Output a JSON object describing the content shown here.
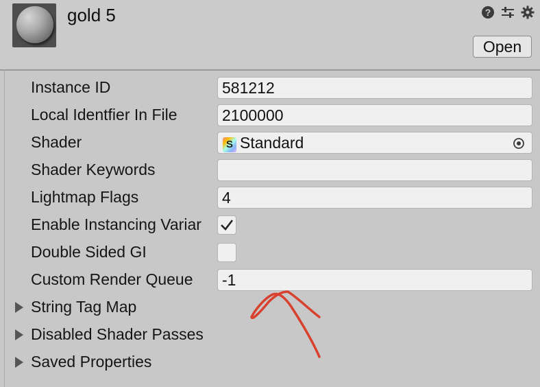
{
  "header": {
    "title": "gold 5",
    "open_label": "Open",
    "icons": [
      "help-icon",
      "presets-sliders-icon",
      "settings-gear-icon"
    ]
  },
  "properties": {
    "instance_id": {
      "label": "Instance ID",
      "value": "581212"
    },
    "local_identifier": {
      "label": "Local Identfier In File",
      "value": "2100000"
    },
    "shader": {
      "label": "Shader",
      "value": "Standard",
      "icon_letter": "S"
    },
    "shader_keywords": {
      "label": "Shader Keywords",
      "value": ""
    },
    "lightmap_flags": {
      "label": "Lightmap Flags",
      "value": "4"
    },
    "enable_instancing": {
      "label": "Enable Instancing Variar",
      "checked": true
    },
    "double_sided_gi": {
      "label": "Double Sided GI",
      "checked": false
    },
    "custom_render_queue": {
      "label": "Custom Render Queue",
      "value": "-1"
    }
  },
  "foldouts": [
    {
      "label": "String Tag Map"
    },
    {
      "label": "Disabled Shader Passes"
    },
    {
      "label": "Saved Properties"
    }
  ],
  "colors": {
    "panel_bg": "#c8c8c8",
    "field_bg": "#f0f0f0",
    "annotation_red": "#d8412e"
  }
}
